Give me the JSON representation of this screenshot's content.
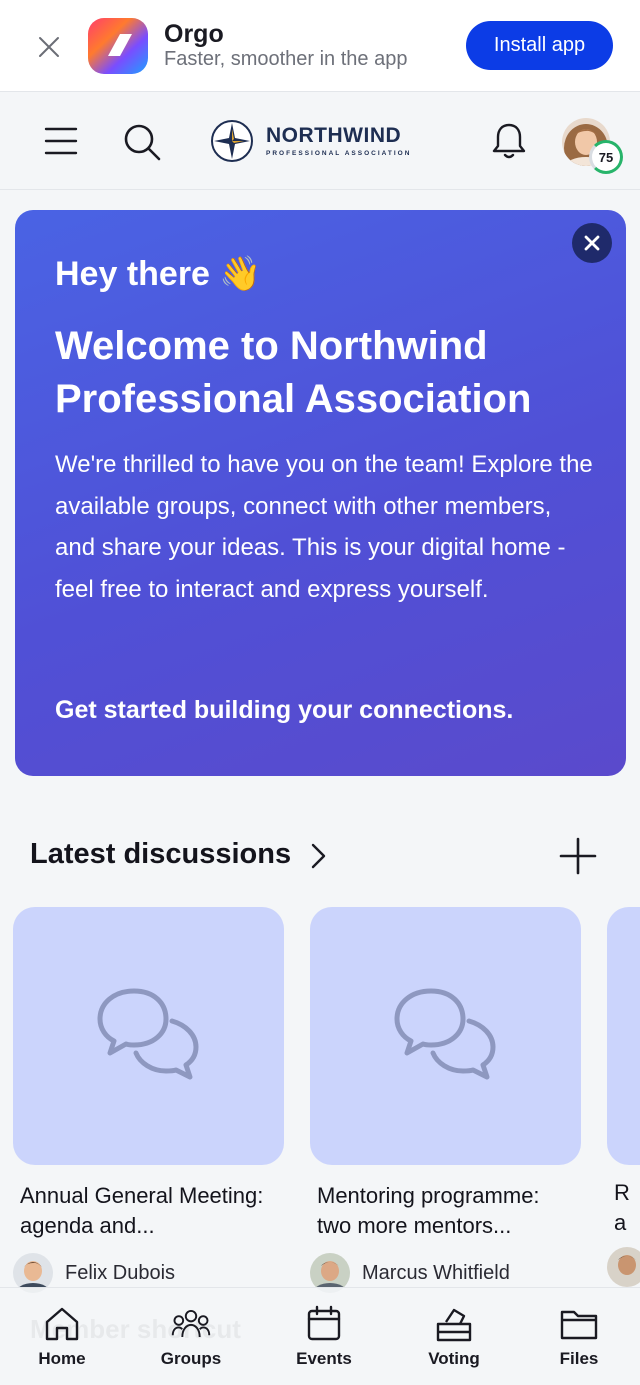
{
  "banner": {
    "app_name": "Orgo",
    "tagline": "Faster, smoother in the app",
    "install_label": "Install app"
  },
  "header": {
    "brand_name": "NORTHWIND",
    "brand_subtitle": "PROFESSIONAL ASSOCIATION",
    "profile_score": "75"
  },
  "welcome": {
    "greeting": "Hey there 👋",
    "title": "Welcome to Northwind Professional Association",
    "body": "We're thrilled to have you on the team! Explore the available groups, connect with other members, and share your ideas. This is your digital home - feel free to interact and express yourself.",
    "cta": "Get started building your connections."
  },
  "discussions": {
    "title": "Latest discussions",
    "items": [
      {
        "title": "Annual General Meeting: agenda and...",
        "author": "Felix Dubois"
      },
      {
        "title": "Mentoring programme: two more mentors...",
        "author": "Marcus Whitfield"
      }
    ],
    "peek_line1": "R",
    "peek_line2": "a"
  },
  "bottom_nav": {
    "ghost_text": "Member shortcut",
    "tabs": [
      {
        "label": "Home"
      },
      {
        "label": "Groups"
      },
      {
        "label": "Events"
      },
      {
        "label": "Voting"
      },
      {
        "label": "Files"
      }
    ]
  },
  "colors": {
    "install_button": "#0c3ce6",
    "welcome_card": "#4f55d9",
    "card_thumb": "#cbd4fc",
    "score_ring": "#27b46a"
  }
}
